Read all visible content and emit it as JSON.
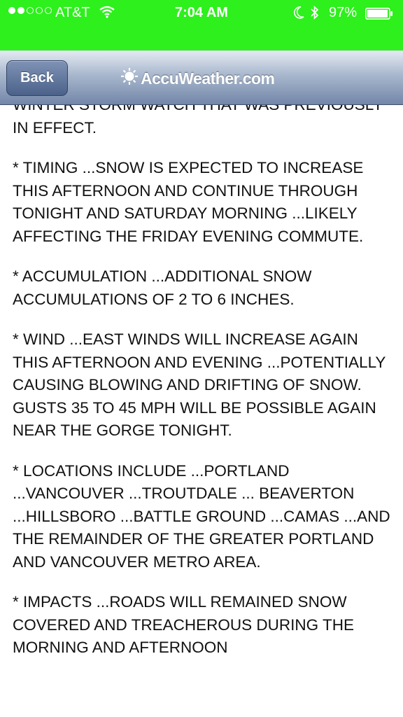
{
  "status_bar": {
    "carrier": "AT&T",
    "time": "7:04 AM",
    "battery_percent": "97%",
    "signal_bars_filled": 2,
    "signal_bars_total": 5,
    "icons": [
      "signal-dots-icon",
      "wifi-icon",
      "moon-icon",
      "bluetooth-icon",
      "battery-icon"
    ],
    "background_color": "#2df01c"
  },
  "nav": {
    "back_label": "Back",
    "brand": "AccuWeather.com",
    "brand_icon": "sun-icon"
  },
  "article": {
    "paragraphs": [
      "WINTER STORM WATCH THAT WAS PREVIOUSLY IN EFFECT.",
      "* TIMING ...SNOW IS EXPECTED TO INCREASE THIS AFTERNOON AND CONTINUE THROUGH TONIGHT AND SATURDAY MORNING ...LIKELY AFFECTING THE FRIDAY EVENING COMMUTE.",
      "* ACCUMULATION ...ADDITIONAL SNOW ACCUMULATIONS OF 2 TO 6 INCHES.",
      "* WIND ...EAST WINDS WILL INCREASE AGAIN THIS AFTERNOON AND EVENING ...POTENTIALLY CAUSING BLOWING AND DRIFTING OF SNOW. GUSTS 35 TO 45 MPH WILL BE POSSIBLE AGAIN NEAR THE GORGE TONIGHT.",
      "* LOCATIONS INCLUDE ...PORTLAND ...VANCOUVER ...TROUTDALE ... BEAVERTON ...HILLSBORO ...BATTLE GROUND ...CAMAS ...AND THE REMAINDER OF THE GREATER PORTLAND AND VANCOUVER METRO AREA.",
      "* IMPACTS ...ROADS WILL REMAINED SNOW COVERED AND TREACHEROUS DURING THE MORNING AND AFTERNOON"
    ]
  }
}
